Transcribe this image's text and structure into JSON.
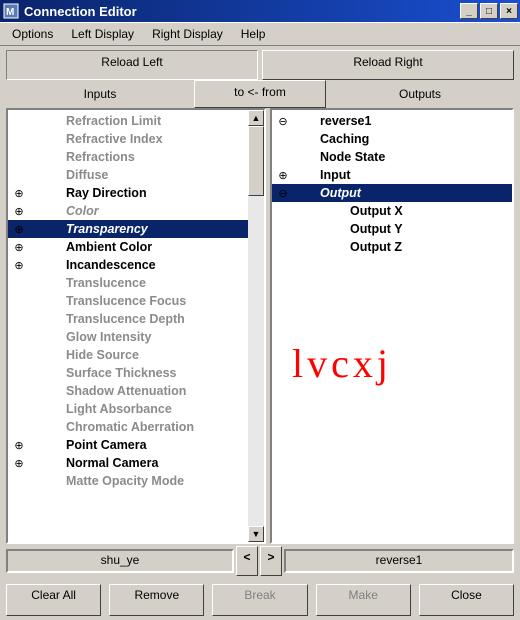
{
  "title": "Connection Editor",
  "menu": {
    "options": "Options",
    "left_display": "Left Display",
    "right_display": "Right Display",
    "help": "Help"
  },
  "reload_left": "Reload Left",
  "reload_right": "Reload Right",
  "inputs_label": "Inputs",
  "outputs_label": "Outputs",
  "direction_label": "to <- from",
  "left_node": "shu_ye",
  "right_node": "reverse1",
  "nav_prev": "<",
  "nav_next": ">",
  "buttons": {
    "clear_all": "Clear All",
    "remove": "Remove",
    "break": "Break",
    "make": "Make",
    "close": "Close"
  },
  "watermark": "lvcxj",
  "chart_data": {
    "type": "table",
    "left_attributes": [
      {
        "label": "Refraction Limit",
        "expand": "",
        "style": "grey"
      },
      {
        "label": "Refractive Index",
        "expand": "",
        "style": "grey"
      },
      {
        "label": "Refractions",
        "expand": "",
        "style": "grey"
      },
      {
        "label": "Diffuse",
        "expand": "",
        "style": "grey"
      },
      {
        "label": "Ray Direction",
        "expand": "⊕",
        "style": "blue"
      },
      {
        "label": "Color",
        "expand": "⊕",
        "style": "italic"
      },
      {
        "label": "Transparency",
        "expand": "⊕",
        "style": "sel-italic"
      },
      {
        "label": "Ambient Color",
        "expand": "⊕",
        "style": "blue"
      },
      {
        "label": "Incandescence",
        "expand": "⊕",
        "style": "blue"
      },
      {
        "label": "Translucence",
        "expand": "",
        "style": "grey"
      },
      {
        "label": "Translucence Focus",
        "expand": "",
        "style": "grey"
      },
      {
        "label": "Translucence Depth",
        "expand": "",
        "style": "grey"
      },
      {
        "label": "Glow Intensity",
        "expand": "",
        "style": "grey"
      },
      {
        "label": "Hide Source",
        "expand": "",
        "style": "grey"
      },
      {
        "label": "Surface Thickness",
        "expand": "",
        "style": "grey"
      },
      {
        "label": "Shadow Attenuation",
        "expand": "",
        "style": "grey"
      },
      {
        "label": "Light Absorbance",
        "expand": "",
        "style": "grey"
      },
      {
        "label": "Chromatic Aberration",
        "expand": "",
        "style": "grey"
      },
      {
        "label": "Point Camera",
        "expand": "⊕",
        "style": "blue"
      },
      {
        "label": "Normal Camera",
        "expand": "⊕",
        "style": "blue"
      },
      {
        "label": "Matte Opacity Mode",
        "expand": "",
        "style": "grey"
      }
    ],
    "right_attributes": [
      {
        "label": "reverse1",
        "expand": "⊖",
        "depth": 0,
        "style": "blue"
      },
      {
        "label": "Caching",
        "expand": "",
        "depth": 1,
        "style": "blue"
      },
      {
        "label": "Node State",
        "expand": "",
        "depth": 1,
        "style": "blue"
      },
      {
        "label": "Input",
        "expand": "⊕",
        "depth": 1,
        "style": "blue"
      },
      {
        "label": "Output",
        "expand": "⊖",
        "depth": 1,
        "style": "sel-italic"
      },
      {
        "label": "Output X",
        "expand": "",
        "depth": 2,
        "style": "blue"
      },
      {
        "label": "Output Y",
        "expand": "",
        "depth": 2,
        "style": "blue"
      },
      {
        "label": "Output Z",
        "expand": "",
        "depth": 2,
        "style": "blue"
      }
    ]
  }
}
